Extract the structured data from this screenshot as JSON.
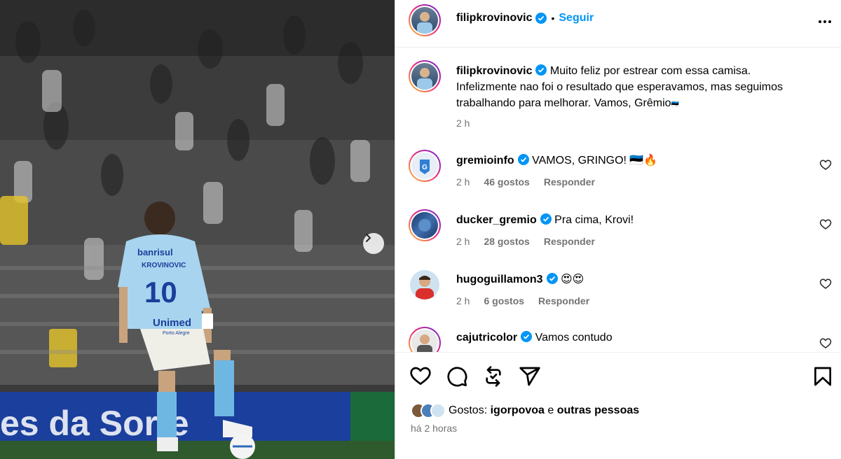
{
  "post": {
    "author": "filipkrovinovic",
    "follow_label": "Seguir",
    "separator": "•",
    "caption": "Muito feliz por estrear com essa camisa. Infelizmente nao foi o resultado que esperavamos, mas seguimos trabalhando para melhorar. Vamos, Grêmio",
    "caption_emoji": "🇪🇪",
    "caption_time": "2 h"
  },
  "photo": {
    "jersey_sponsor": "banrisul",
    "jersey_name": "KROVINOVIC",
    "jersey_number": "10",
    "jersey_sponsor2": "Unimed",
    "jersey_sponsor2_sub": "Porto Alegre",
    "banner_text": "es da Sorte"
  },
  "comments": [
    {
      "user": "gremioinfo",
      "text": "VAMOS, GRINGO! 🇪🇪🔥",
      "time": "2 h",
      "likes": "46 gostos",
      "reply": "Responder"
    },
    {
      "user": "ducker_gremio",
      "text": "Pra cima, Krovi!",
      "time": "2 h",
      "likes": "28 gostos",
      "reply": "Responder"
    },
    {
      "user": "hugoguillamon3",
      "text": "😍😍",
      "time": "2 h",
      "likes": "6 gostos",
      "reply": "Responder"
    },
    {
      "user": "cajutricolor",
      "text": "Vamos contudo",
      "time": "",
      "likes": "",
      "reply": ""
    }
  ],
  "likes": {
    "prefix": "Gostos:",
    "user": "igorpovoa",
    "connector": "e",
    "others": "outras pessoas"
  },
  "posted_ago": "há 2 horas",
  "colors": {
    "accent": "#0095f6",
    "muted": "#737373",
    "verified": "#0095f6"
  }
}
